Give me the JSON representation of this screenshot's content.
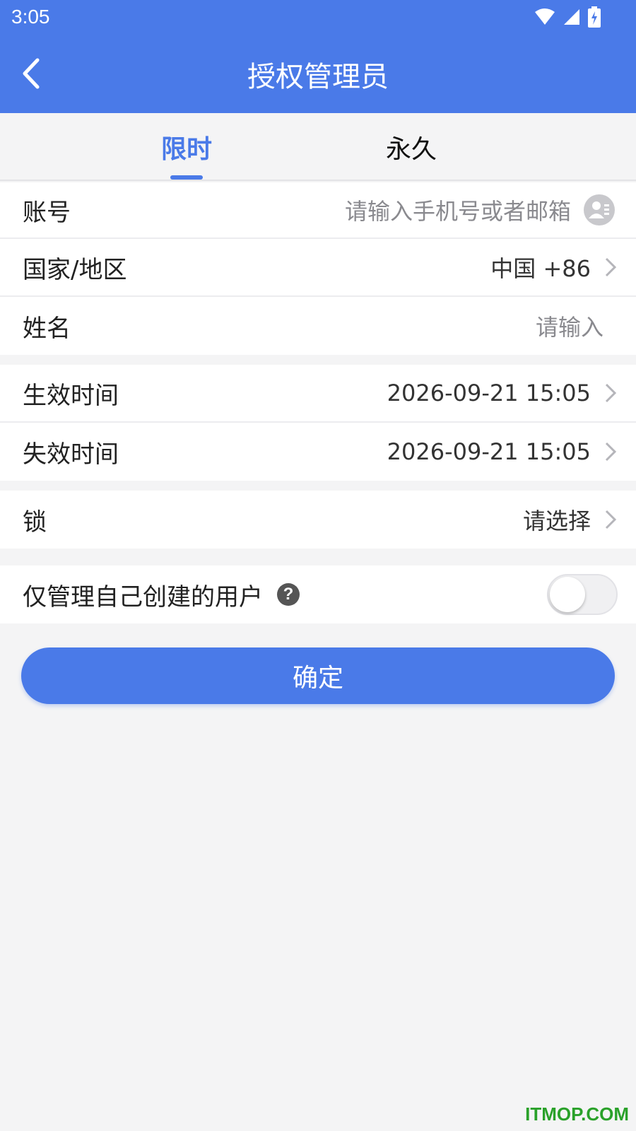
{
  "status_bar": {
    "time": "3:05"
  },
  "header": {
    "title": "授权管理员"
  },
  "tabs": [
    {
      "label": "限时",
      "active": true
    },
    {
      "label": "永久",
      "active": false
    }
  ],
  "form": {
    "account": {
      "label": "账号",
      "placeholder": "请输入手机号或者邮箱"
    },
    "region": {
      "label": "国家/地区",
      "value": "中国 +86"
    },
    "name": {
      "label": "姓名",
      "placeholder": "请输入"
    },
    "start_time": {
      "label": "生效时间",
      "value": "2026-09-21 15:05"
    },
    "end_time": {
      "label": "失效时间",
      "value": "2026-09-21 15:05"
    },
    "lock": {
      "label": "锁",
      "placeholder": "请选择"
    },
    "manage_own": {
      "label": "仅管理自己创建的用户",
      "help_icon": "?",
      "enabled": false
    }
  },
  "confirm_button": {
    "label": "确定"
  },
  "watermark": "ITMOP.COM",
  "colors": {
    "accent": "#4a7ae8",
    "background": "#f4f4f5"
  }
}
